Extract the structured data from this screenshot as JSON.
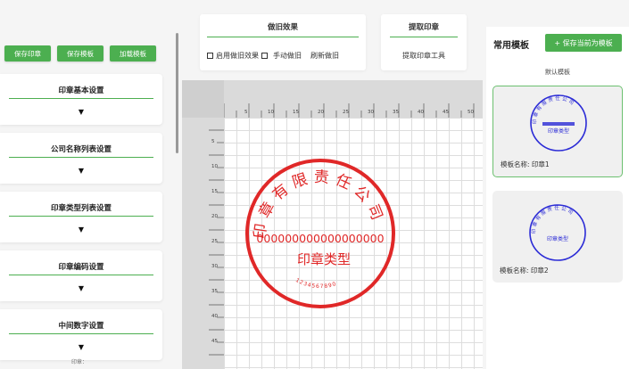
{
  "left_panel": {
    "buttons": [
      "保存印章",
      "保存模板",
      "加载模板"
    ],
    "sections": [
      {
        "title": "印章基本设置",
        "arrow": "▼"
      },
      {
        "title": "公司名称列表设置",
        "arrow": "▼"
      },
      {
        "title": "印章类型列表设置",
        "arrow": "▼"
      },
      {
        "title": "印章编码设置",
        "arrow": "▼"
      },
      {
        "title": "中间数字设置",
        "arrow": "▼"
      }
    ],
    "bottom_text": "印章："
  },
  "aging_panel": {
    "title": "做旧效果",
    "checkbox_label": "启用做旧效果",
    "manual_label": "手动做旧",
    "refresh_label": "刷新做旧"
  },
  "extract_panel": {
    "title": "提取印章",
    "tool_label": "提取印章工具"
  },
  "ruler": {
    "top_ticks": [
      "0",
      "5",
      "10",
      "15",
      "20",
      "25",
      "30",
      "35",
      "40",
      "45",
      "50",
      "55",
      "60",
      "65"
    ],
    "left_ticks": [
      "5",
      "10",
      "15",
      "20",
      "25",
      "30",
      "35",
      "40",
      "45"
    ]
  },
  "stamp": {
    "company": "印章有限责任公司",
    "number": "000000000000000000",
    "type": "印章类型",
    "code": "1234567890",
    "left_char": "公",
    "color": "#e02828"
  },
  "right_panel": {
    "title": "常用模板",
    "save_label": "+ 保存当前为模板",
    "default_label": "默认模板",
    "templates": [
      {
        "name": "模板名称: 印章1",
        "mini_color": "#2b2bd6"
      },
      {
        "name": "模板名称: 印章2",
        "mini_color": "#2b2bd6"
      }
    ]
  },
  "colors": {
    "accent": "#4caf50",
    "stamp": "#e02828",
    "template_stamp": "#2b2bd6"
  }
}
